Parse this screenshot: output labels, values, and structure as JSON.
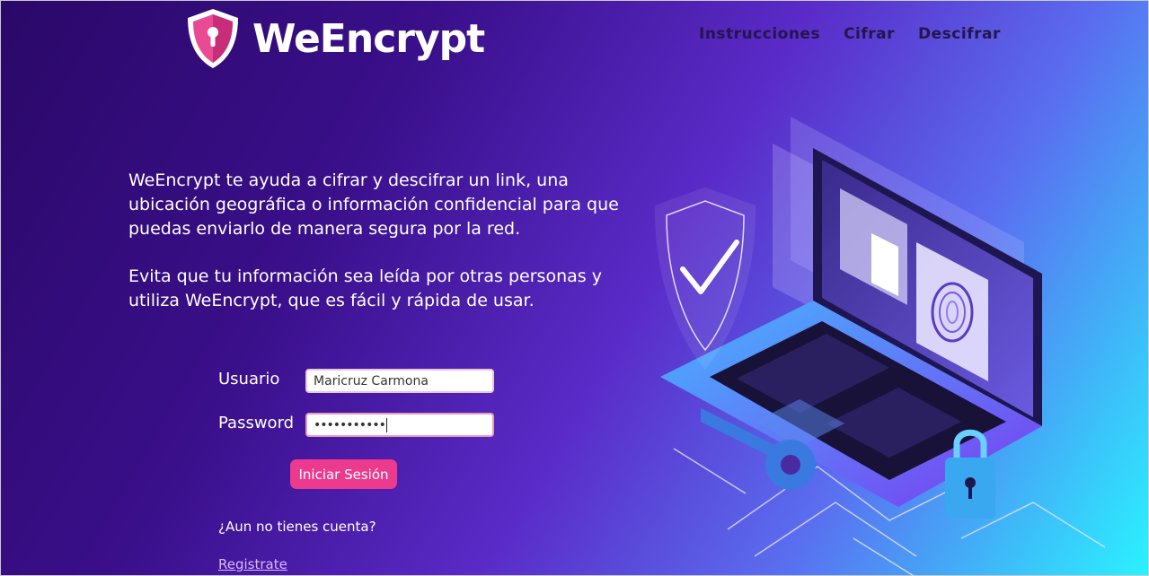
{
  "brand": {
    "name": "WeEncrypt"
  },
  "nav": {
    "items": [
      {
        "label": "Instrucciones"
      },
      {
        "label": "Cifrar"
      },
      {
        "label": "Descifrar"
      }
    ]
  },
  "intro": {
    "paragraph1": "WeEncrypt te ayuda a cifrar y descifrar un link, una ubicación geográfica o información confidencial para que puedas enviarlo de manera segura por la red.",
    "paragraph2": "Evita que tu información sea leída por otras personas y utiliza WeEncrypt, que es fácil y rápida de usar."
  },
  "login": {
    "user_label": "Usuario",
    "user_value": "Maricruz Carmona",
    "password_label": "Password",
    "password_value": "•••••••••••",
    "submit_label": "Iniciar Sesión",
    "no_account_text": "¿Aun no tienes cuenta?",
    "register_label": "Registrate"
  },
  "colors": {
    "accent": "#ec3b8e",
    "nav_text": "#22164a",
    "bg_start": "#2a0868",
    "bg_end": "#2af3ff"
  },
  "icons": {
    "logo": "shield-keyhole-icon",
    "illustration": "laptop-security-illustration"
  }
}
